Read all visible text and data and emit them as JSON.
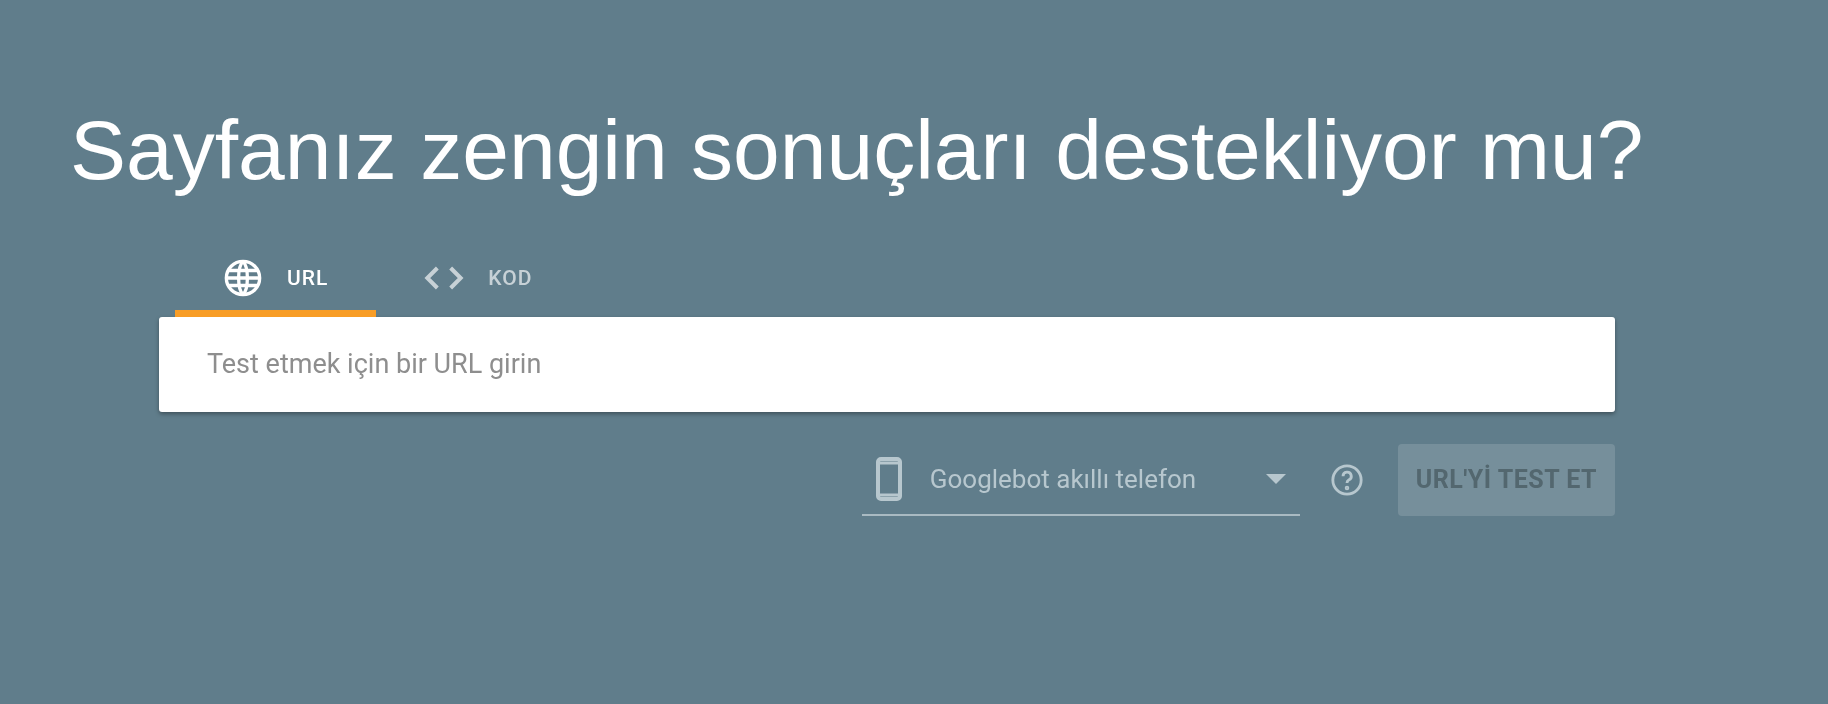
{
  "heading": "Sayfanız zengin sonuçları destekliyor mu?",
  "tabs": [
    {
      "label": "URL",
      "kind": "url",
      "selected": true
    },
    {
      "label": "KOD",
      "kind": "code",
      "selected": false
    }
  ],
  "url_field": {
    "placeholder": "Test etmek için bir URL girin"
  },
  "user_agent": {
    "value": "Googlebot akıllı telefon"
  },
  "test_button": {
    "label": "URL'Yİ TEST ET",
    "disabled": true
  }
}
